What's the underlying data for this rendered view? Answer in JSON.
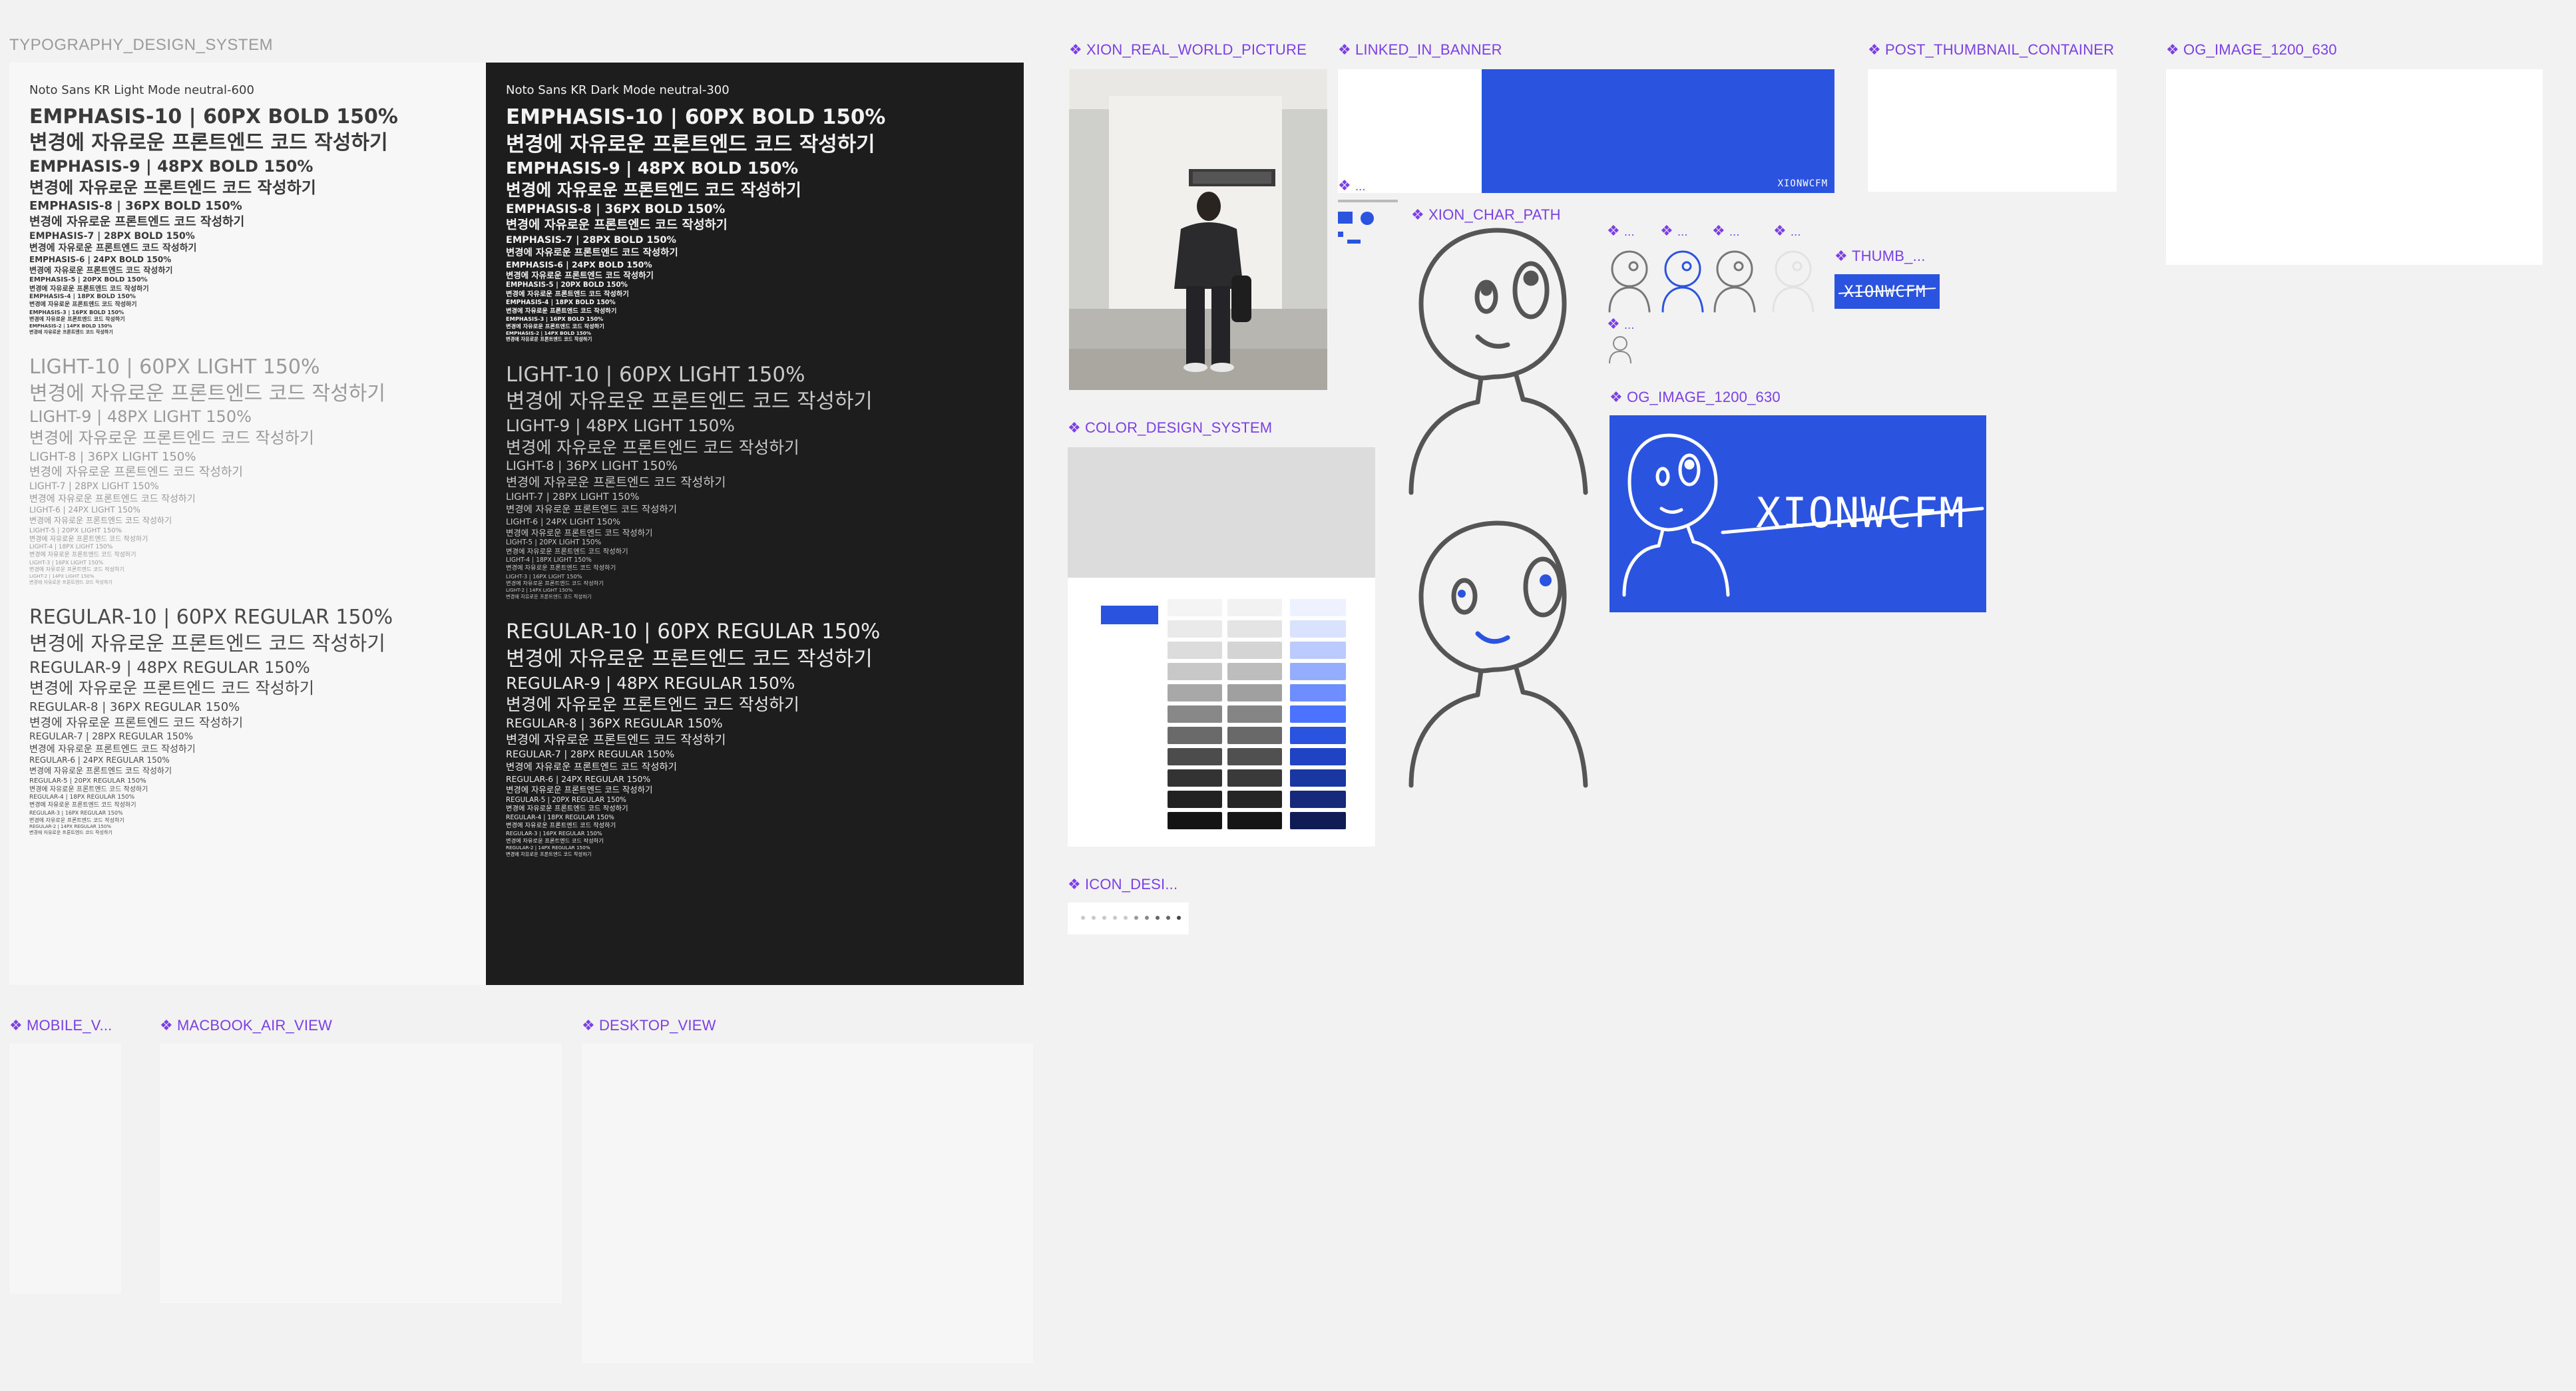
{
  "canvas": {
    "section_title": "TYPOGRAPHY_DESIGN_SYSTEM",
    "frames": {
      "real_picture": "XION_REAL_WORLD_PICTURE",
      "linkedin_banner": "LINKED_IN_BANNER",
      "post_thumbnail": "POST_THUMBNAIL_CONTAINER",
      "og_image_top": "OG_IMAGE_1200_630",
      "char_path": "XION_CHAR_PATH",
      "thumb": "THUMB_...",
      "og_image_mid": "OG_IMAGE_1200_630",
      "color_system": "COLOR_DESIGN_SYSTEM",
      "icon_system": "ICON_DESI...",
      "mobile_view": "MOBILE_V...",
      "macbook_view": "MACBOOK_AIR_VIEW",
      "desktop_view": "DESKTOP_VIEW",
      "small_1": "...",
      "small_2": "...",
      "small_3": "...",
      "small_4": "...",
      "small_5": "...",
      "small_6": "..."
    }
  },
  "brand": {
    "logo_text": "XIONWCFM",
    "accent": "#2a53e0",
    "frame_label_color": "#7b3fe4"
  },
  "typography": {
    "light_header": "Noto Sans KR Light Mode  neutral-600",
    "dark_header": "Noto Sans KR Dark Mode  neutral-300",
    "sample_kr": "변경에 자유로운 프론트엔드 코드 작성하기",
    "bold": [
      {
        "label": "EMPHASIS-10 | 60PX BOLD 150%",
        "size": 30
      },
      {
        "label": "EMPHASIS-9 | 48PX BOLD 150%",
        "size": 24
      },
      {
        "label": "EMPHASIS-8 | 36PX BOLD 150%",
        "size": 18
      },
      {
        "label": "EMPHASIS-7 | 28PX BOLD 150%",
        "size": 14
      },
      {
        "label": "EMPHASIS-6 | 24PX BOLD 150%",
        "size": 12
      },
      {
        "label": "EMPHASIS-5 | 20PX BOLD 150%",
        "size": 10
      },
      {
        "label": "EMPHASIS-4 | 18PX BOLD 150%",
        "size": 9
      },
      {
        "label": "EMPHASIS-3 | 16PX BOLD 150%",
        "size": 8
      },
      {
        "label": "EMPHASIS-2 | 14PX BOLD 150%",
        "size": 7
      }
    ],
    "light": [
      {
        "label": "LIGHT-10 | 60PX LIGHT 150%",
        "size": 30
      },
      {
        "label": "LIGHT-9 | 48PX LIGHT 150%",
        "size": 24
      },
      {
        "label": "LIGHT-8 | 36PX LIGHT 150%",
        "size": 18
      },
      {
        "label": "LIGHT-7 | 28PX LIGHT 150%",
        "size": 14
      },
      {
        "label": "LIGHT-6 | 24PX LIGHT 150%",
        "size": 12
      },
      {
        "label": "LIGHT-5 | 20PX LIGHT 150%",
        "size": 10
      },
      {
        "label": "LIGHT-4 | 18PX LIGHT 150%",
        "size": 9
      },
      {
        "label": "LIGHT-3 | 16PX LIGHT 150%",
        "size": 8
      },
      {
        "label": "LIGHT-2 | 14PX LIGHT 150%",
        "size": 7
      }
    ],
    "regular": [
      {
        "label": "REGULAR-10 | 60PX REGULAR 150%",
        "size": 30
      },
      {
        "label": "REGULAR-9 | 48PX REGULAR 150%",
        "size": 24
      },
      {
        "label": "REGULAR-8 | 36PX REGULAR 150%",
        "size": 18
      },
      {
        "label": "REGULAR-7 | 28PX REGULAR 150%",
        "size": 14
      },
      {
        "label": "REGULAR-6 | 24PX REGULAR 150%",
        "size": 12
      },
      {
        "label": "REGULAR-5 | 20PX REGULAR 150%",
        "size": 10
      },
      {
        "label": "REGULAR-4 | 18PX REGULAR 150%",
        "size": 9
      },
      {
        "label": "REGULAR-3 | 16PX REGULAR 150%",
        "size": 8
      },
      {
        "label": "REGULAR-2 | 14PX REGULAR 150%",
        "size": 7
      }
    ]
  },
  "palette": {
    "neutral": [
      "#f4f4f4",
      "#eaeaea",
      "#dcdcdc",
      "#c8c8c8",
      "#a8a8a8",
      "#888888",
      "#6a6a6a",
      "#4c4c4c",
      "#333333",
      "#222222",
      "#141414"
    ],
    "gray": [
      "#f2f2f2",
      "#e4e4e4",
      "#d4d4d4",
      "#bdbdbd",
      "#a0a0a0",
      "#858585",
      "#696969",
      "#505050",
      "#3a3a3a",
      "#262626",
      "#161616"
    ],
    "primary": [
      "#eef2ff",
      "#d9e2ff",
      "#bccbff",
      "#94adff",
      "#6e8eff",
      "#4c73ff",
      "#2a53e0",
      "#1f43c2",
      "#1a36a0",
      "#16297a",
      "#101c55"
    ]
  }
}
